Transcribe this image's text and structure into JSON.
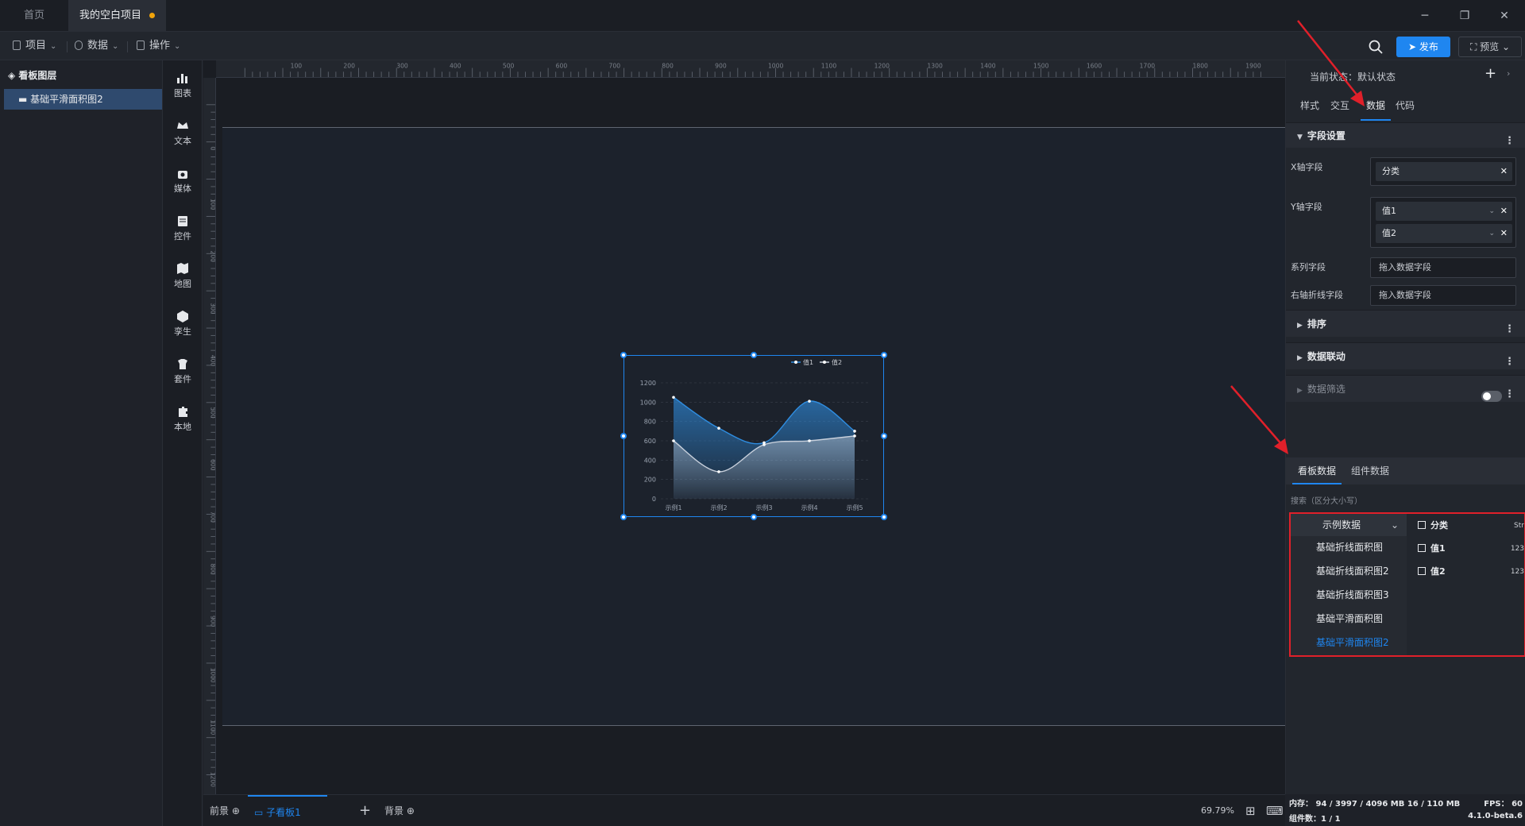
{
  "titlebar": {
    "tabs": [
      {
        "label": "首页"
      },
      {
        "label": "我的空白项目"
      }
    ]
  },
  "menubar": {
    "project": "项目",
    "data": "数据",
    "operate": "操作",
    "publish": "发布",
    "preview": "预览"
  },
  "layers": {
    "header": "看板图层",
    "items": [
      {
        "label": "基础平滑面积图2"
      }
    ]
  },
  "tools": [
    {
      "label": "图表",
      "icon": "bar-chart-icon"
    },
    {
      "label": "文本",
      "icon": "text-icon"
    },
    {
      "label": "媒体",
      "icon": "media-icon"
    },
    {
      "label": "控件",
      "icon": "control-icon"
    },
    {
      "label": "地图",
      "icon": "map-icon"
    },
    {
      "label": "孪生",
      "icon": "twin-icon"
    },
    {
      "label": "套件",
      "icon": "kit-icon"
    },
    {
      "label": "本地",
      "icon": "local-icon"
    }
  ],
  "ruler": {
    "top_ticks": [
      "100",
      "200",
      "300",
      "400",
      "500",
      "600",
      "700",
      "800",
      "900",
      "1000",
      "1100",
      "1200",
      "1300",
      "1400",
      "1500",
      "1600",
      "1700",
      "1800",
      "1900"
    ],
    "left_ticks": [
      "0",
      "100",
      "200",
      "300",
      "400",
      "500",
      "600",
      "700",
      "800",
      "900",
      "1000",
      "1100",
      "1200"
    ]
  },
  "chart_data": {
    "type": "area",
    "categories": [
      "示例1",
      "示例2",
      "示例3",
      "示例4",
      "示例5"
    ],
    "series": [
      {
        "name": "值1",
        "values": [
          1050,
          730,
          580,
          1010,
          700
        ],
        "color": "#2f8de0"
      },
      {
        "name": "值2",
        "values": [
          600,
          280,
          560,
          600,
          650
        ],
        "color": "#c8d0dc"
      }
    ],
    "yticks": [
      "0",
      "200",
      "400",
      "600",
      "800",
      "1000",
      "1200"
    ],
    "ylim": [
      0,
      1200
    ],
    "legend": "top-right",
    "grid": true
  },
  "bottombar": {
    "foreground": "前景",
    "subboard": "子看板1",
    "background": "背景",
    "zoom": "69.79%"
  },
  "rpanel": {
    "state_label": "当前状态：默认状态",
    "tabs": [
      "样式",
      "交互",
      "数据",
      "代码"
    ],
    "field_settings": "字段设置",
    "x_field_label": "X轴字段",
    "x_field_value": "分类",
    "y_field_label": "Y轴字段",
    "y_fields": [
      "值1",
      "值2"
    ],
    "series_label": "系列字段",
    "series_placeholder": "拖入数据字段",
    "right_axis_label": "右轴折线字段",
    "right_axis_placeholder": "拖入数据字段",
    "sort": "排序",
    "linkage": "数据联动",
    "filter": "数据筛选",
    "data_tabs": [
      "看板数据",
      "组件数据"
    ],
    "search_hint": "搜索（区分大小写）",
    "dataset_select": "示例数据",
    "datasets": [
      "基础折线面积图",
      "基础折线面积图2",
      "基础折线面积图3",
      "基础平滑面积图",
      "基础平滑面积图2"
    ],
    "fields": [
      {
        "name": "分类",
        "type": "Str"
      },
      {
        "name": "值1",
        "type": "123"
      },
      {
        "name": "值2",
        "type": "123"
      }
    ],
    "status": {
      "memory": "内存：  94 / 3997 / 4096 MB  16 / 110 MB",
      "fps": "FPS：  60",
      "components": "组件数：1 / 1",
      "version": "4.1.0-beta.6"
    }
  },
  "colors": {
    "accent": "#1f86f0",
    "annotation": "#e0202a"
  }
}
